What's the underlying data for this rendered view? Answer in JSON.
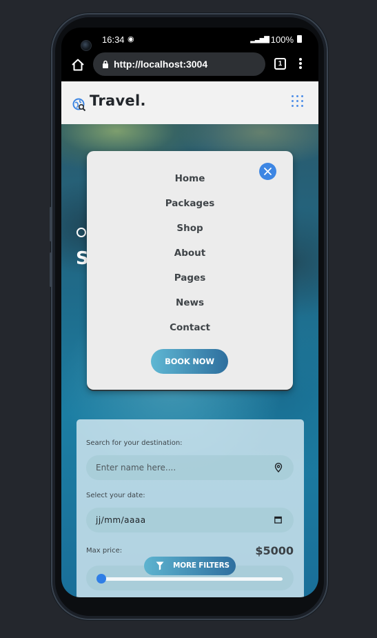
{
  "status_bar": {
    "time": "16:34",
    "battery": "100%",
    "music_icon": "spotify-icon"
  },
  "browser": {
    "url": "http://localhost:3004",
    "tab_count": "1"
  },
  "site": {
    "logo_text": "Travel.",
    "logo_icon": "globe-search-icon",
    "menu_icon": "grid-dots-icon",
    "accent_color": "#3d86e3"
  },
  "hero": {
    "partial_line_1": "O",
    "partial_line_2": "S"
  },
  "nav_menu": {
    "items": [
      {
        "label": "Home"
      },
      {
        "label": "Packages"
      },
      {
        "label": "Shop"
      },
      {
        "label": "About"
      },
      {
        "label": "Pages"
      },
      {
        "label": "News"
      },
      {
        "label": "Contact"
      }
    ],
    "book_now": "BOOK NOW"
  },
  "search": {
    "destination_label": "Search for your destination:",
    "destination_placeholder": "Enter name here....",
    "date_label": "Select your date:",
    "date_value": "jj/mm/aaaa",
    "price_label": "Max price:",
    "price_value": "$5000",
    "price_slider_fraction": 0.0,
    "more_filters": "MORE FILTERS"
  }
}
